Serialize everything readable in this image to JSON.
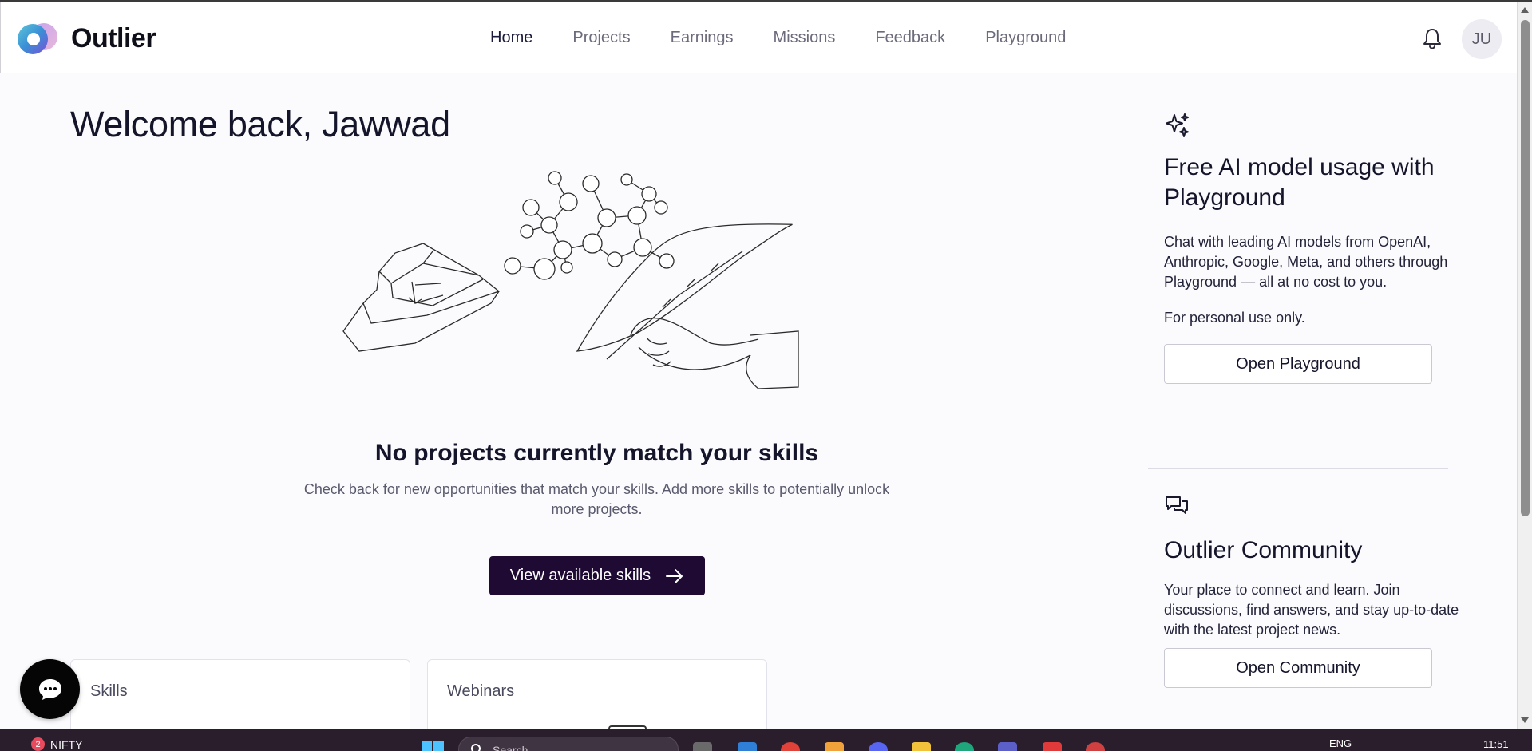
{
  "header": {
    "brand": "Outlier",
    "nav": [
      {
        "label": "Home",
        "active": true
      },
      {
        "label": "Projects",
        "active": false
      },
      {
        "label": "Earnings",
        "active": false
      },
      {
        "label": "Missions",
        "active": false
      },
      {
        "label": "Feedback",
        "active": false
      },
      {
        "label": "Playground",
        "active": false
      }
    ],
    "avatar_initials": "JU"
  },
  "main": {
    "welcome": "Welcome back, Jawwad",
    "empty_title": "No projects currently match your skills",
    "empty_desc": "Check back for new opportunities that match your skills. Add more skills to potentially unlock more projects.",
    "cta_label": "View available skills",
    "cards": [
      {
        "title": "Skills"
      },
      {
        "title": "Webinars"
      }
    ]
  },
  "side": {
    "playground": {
      "title": "Free AI model usage with Playground",
      "desc": "Chat with leading AI models from OpenAI, Anthropic, Google, Meta, and others through Playground — all at no cost to you.",
      "note": "For personal use only.",
      "button": "Open Playground"
    },
    "community": {
      "title": "Outlier Community",
      "desc": "Your place to connect and learn. Join discussions, find answers, and stay up-to-date with the latest project news.",
      "button": "Open Community"
    }
  },
  "taskbar": {
    "badge_count": "2",
    "ticker": "NIFTY",
    "search_placeholder": "Search",
    "language": "ENG",
    "time": "11:51"
  },
  "colors": {
    "cta_bg": "#1e0a33",
    "page_bg": "#fbfbfd",
    "taskbar_bg": "#2a1d2c"
  }
}
